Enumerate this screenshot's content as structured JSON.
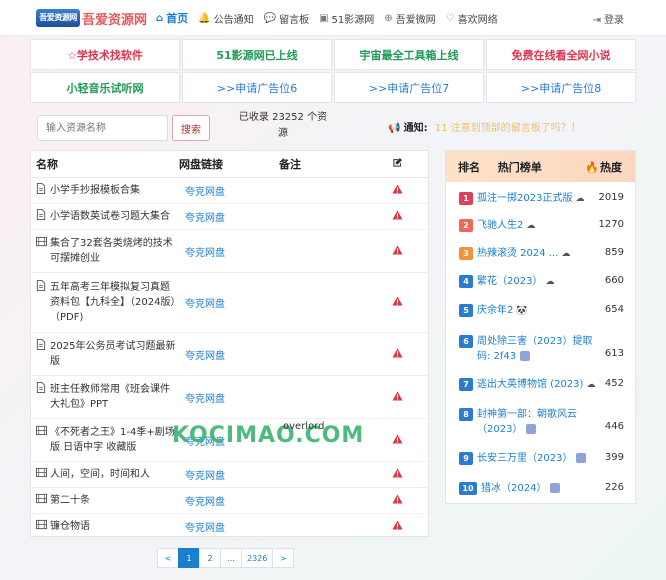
{
  "brand": {
    "logo_badge": "吾爱资源网",
    "title": "吾爱资源网"
  },
  "nav": [
    {
      "icon": "⌂",
      "icon_name": "home-icon",
      "label": "首页",
      "active": true
    },
    {
      "icon": "🔔",
      "icon_name": "bell-icon",
      "label": "公告通知"
    },
    {
      "icon": "💬",
      "icon_name": "chat-icon",
      "label": "留言板"
    },
    {
      "icon": "▣",
      "icon_name": "film-icon",
      "label": "51影源网"
    },
    {
      "icon": "⊕",
      "icon_name": "globe-icon",
      "label": "吾爱微网"
    },
    {
      "icon": "♡",
      "icon_name": "heart-icon",
      "label": "喜欢网络"
    }
  ],
  "login": {
    "icon": "⇥",
    "label": "登录"
  },
  "ads": [
    {
      "label": "☆学技术找软件",
      "color": "red"
    },
    {
      "label": "51影源网已上线",
      "color": "green"
    },
    {
      "label": "宇宙最全工具箱上线",
      "color": "green"
    },
    {
      "label": "免费在线看全网小说",
      "color": "red"
    },
    {
      "label": "小轻音乐试听网",
      "color": "green"
    },
    {
      "label": ">>申请广告位6",
      "color": "blue"
    },
    {
      "label": ">>申请广告位7",
      "color": "blue"
    },
    {
      "label": ">>申请广告位8",
      "color": "blue"
    }
  ],
  "search": {
    "placeholder": "输入资源名称",
    "button": "搜索"
  },
  "count_text": "已收录 23252 个资源",
  "notice": {
    "icon": "📢",
    "label": "通知:",
    "text": "11 注意到顶部的留言板了吗？！"
  },
  "table": {
    "headers": {
      "name": "名称",
      "link": "网盘链接",
      "note": "备注",
      "action_icon": "edit-icon"
    },
    "rows": [
      {
        "icon": "doc",
        "name": "小学手抄报模板合集",
        "link": "夸克网盘",
        "height": 26
      },
      {
        "icon": "doc",
        "name": "小学语数英试卷习题大集合",
        "link": "夸克网盘",
        "height": 26
      },
      {
        "icon": "film",
        "name": "集合了32套各类烧烤的技术可摆摊创业",
        "link": "夸克网盘",
        "height": 43
      },
      {
        "icon": "doc",
        "name": "五年高考三年模拟复习真题资料包【九科全】（2024版）（PDF)",
        "link": "夸克网盘",
        "height": 60
      },
      {
        "icon": "doc",
        "name": "2025年公务员考试习题最新版",
        "link": "夸克网盘",
        "height": 43
      },
      {
        "icon": "doc",
        "name": "班主任教师常用《班会课件大礼包》PPT",
        "link": "夸克网盘",
        "height": 43
      },
      {
        "icon": "film",
        "name": "《不死者之王》1-4季+剧场版 日语中字 收藏版",
        "link": "夸克网盘",
        "height": 43
      },
      {
        "icon": "film",
        "name": "人间，空间，时间和人",
        "link": "夸克网盘",
        "height": 26
      },
      {
        "icon": "film",
        "name": "第二十条",
        "link": "夸克网盘",
        "height": 26
      },
      {
        "icon": "film",
        "name": "镰仓物语",
        "link": "夸克网盘",
        "height": 26
      }
    ]
  },
  "watermark": {
    "text": "KOCIMAO.COM",
    "overlay": "overlord"
  },
  "pagination": [
    "<",
    "1",
    "2",
    "...",
    "2326",
    ">"
  ],
  "ranking": {
    "headers": {
      "rank": "排名",
      "list": "热门榜单",
      "heat": "热度"
    },
    "items": [
      {
        "n": "1",
        "title": "孤注一掷2023正式版",
        "icon": "cloud",
        "heat": "2019",
        "color": "#e04058"
      },
      {
        "n": "2",
        "title": "飞驰人生2",
        "icon": "cloud",
        "heat": "1270",
        "color": "#f0685a"
      },
      {
        "n": "3",
        "title": "热辣滚烫 2024 ...",
        "icon": "cloud",
        "heat": "859",
        "color": "#f5913d"
      },
      {
        "n": "4",
        "title": "繁花（2023）",
        "icon": "cloud",
        "heat": "660",
        "color": "#2b7ccf"
      },
      {
        "n": "5",
        "title": "庆余年2",
        "icon": "panda",
        "heat": "654",
        "color": "#2b7ccf"
      },
      {
        "n": "6",
        "title": "周处除三害（2023）提取码: 2f43",
        "icon": "box",
        "heat": "613",
        "color": "#2b7ccf"
      },
      {
        "n": "7",
        "title": "逃出大英博物馆 (2023)",
        "icon": "cloud",
        "heat": "452",
        "color": "#2b7ccf"
      },
      {
        "n": "8",
        "title": "封神第一部：朝歌风云（2023）",
        "icon": "box",
        "heat": "446",
        "color": "#2b7ccf"
      },
      {
        "n": "9",
        "title": "长安三万里（2023）",
        "icon": "box",
        "heat": "399",
        "color": "#2b7ccf"
      },
      {
        "n": "10",
        "title": "猎冰（2024）",
        "icon": "box",
        "heat": "226",
        "color": "#2b7ccf"
      }
    ]
  }
}
